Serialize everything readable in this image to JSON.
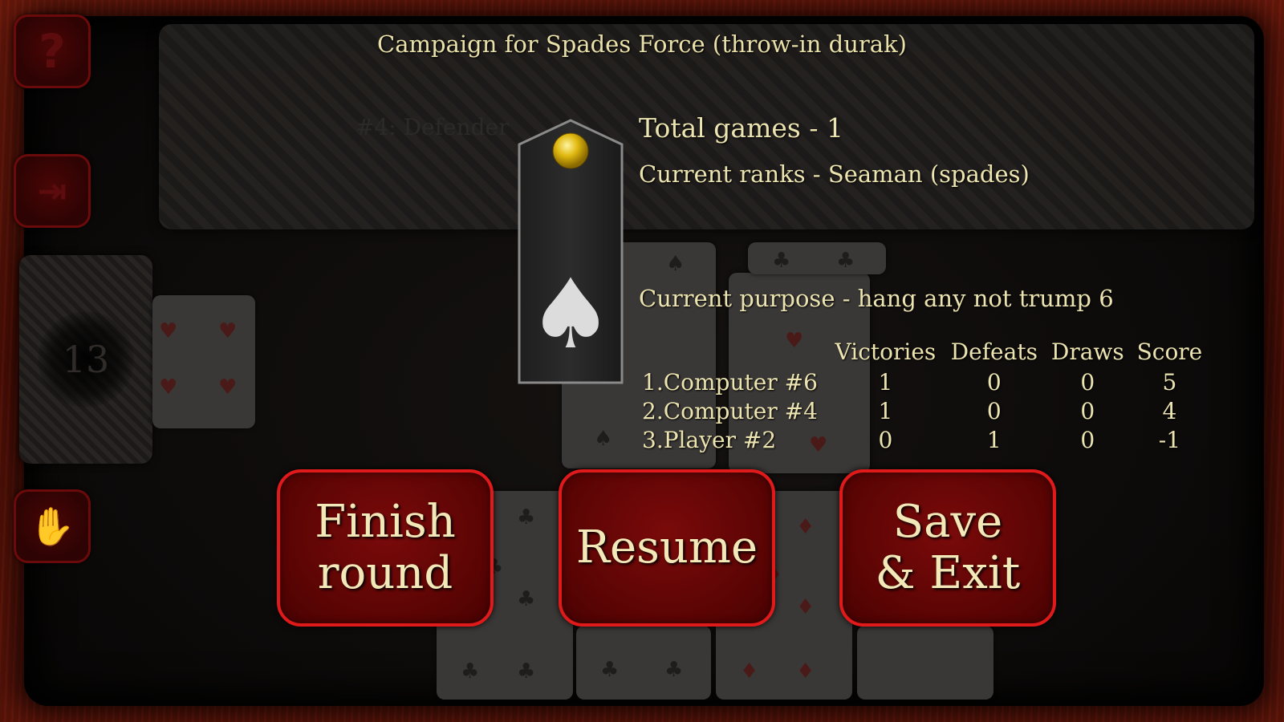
{
  "title": "Campaign for Spades Force (throw-in durak)",
  "opponent_label": "#4: Defender",
  "deck_count": "13",
  "stats": {
    "total_games": "Total games - 1",
    "current_ranks": "Current ranks - Seaman (spades)",
    "current_purpose": "Current purpose - hang any not trump 6"
  },
  "scoreboard": {
    "headers": [
      "Victories",
      "Defeats",
      "Draws",
      "Score"
    ],
    "rows": [
      {
        "name": "1.Computer #6",
        "victories": "1",
        "defeats": "0",
        "draws": "0",
        "score": "5"
      },
      {
        "name": "2.Computer #4",
        "victories": "1",
        "defeats": "0",
        "draws": "0",
        "score": "4"
      },
      {
        "name": "3.Player #2",
        "victories": "0",
        "defeats": "1",
        "draws": "0",
        "score": "-1"
      }
    ]
  },
  "buttons": {
    "finish_line1": "Finish",
    "finish_line2": "round",
    "resume": "Resume",
    "save_line1": "Save",
    "save_line2": "& Exit"
  },
  "side_icons": {
    "help": "?",
    "forward": "⇥",
    "hand": "✋"
  },
  "colors": {
    "button_border": "#e01a1a",
    "button_fill": "#5a0404",
    "text": "#ece4b0"
  }
}
